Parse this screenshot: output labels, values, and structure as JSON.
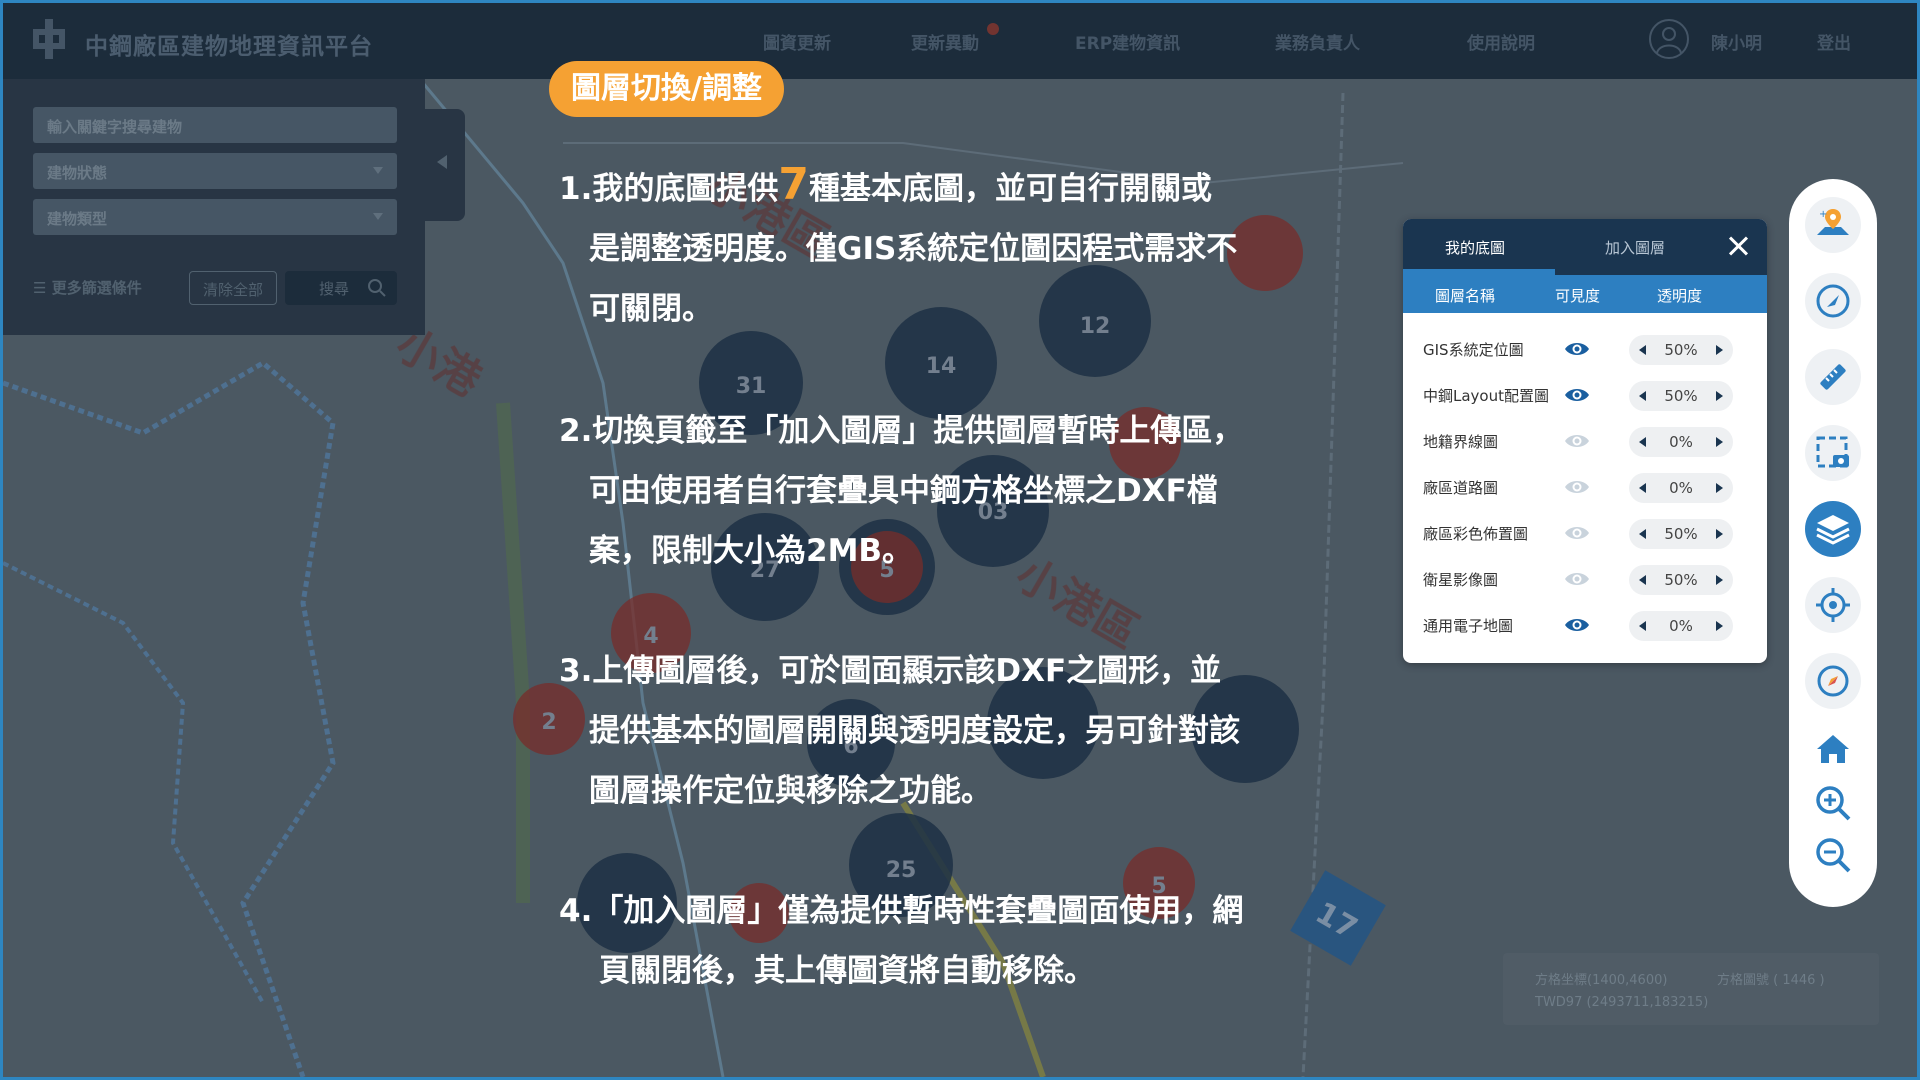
{
  "header": {
    "brand": "中鋼廠區建物地理資訊平台",
    "nav": [
      "圖資更新",
      "更新異動",
      "ERP建物資訊",
      "業務負責人",
      "使用說明"
    ],
    "user": "陳小明",
    "logout": "登出"
  },
  "search": {
    "keyword_placeholder": "輸入關鍵字搜尋建物",
    "status": "建物狀態",
    "type": "建物類型",
    "more": "更多篩選條件",
    "clear": "清除全部",
    "search": "搜尋"
  },
  "tutorial": {
    "pill": "圖層切換/調整",
    "p1_pre": "1.我的底圖提供",
    "p1_num": "7",
    "p1_post": "種基本底圖，並可自行開關或",
    "p1_l2": "是調整透明度。僅GIS系統定位圖因程式需求不",
    "p1_l3": "可關閉。",
    "p2_l1": "2.切換頁籤至「加入圖層」提供圖層暫時上傳區，",
    "p2_l2": "可由使用者自行套疊具中鋼方格坐標之DXF檔",
    "p2_l3": "案，限制大小為2MB。",
    "p3_l1": "3.上傳圖層後，可於圖面顯示該DXF之圖形，並",
    "p3_l2": "提供基本的圖層開關與透明度設定，另可針對該",
    "p3_l3": "圖層操作定位與移除之功能。",
    "p4_l1": "4.「加入圖層」僅為提供暫時性套疊圖面使用，網",
    "p4_l2": "頁關閉後，其上傳圖資將自動移除。"
  },
  "layer_panel": {
    "tab_basemap": "我的底圖",
    "tab_add": "加入圖層",
    "col_name": "圖層名稱",
    "col_visible": "可見度",
    "col_opacity": "透明度",
    "layers": [
      {
        "name": "GIS系統定位圖",
        "visible": true,
        "opacity": "50%"
      },
      {
        "name": "中鋼Layout配置圖",
        "visible": true,
        "opacity": "50%"
      },
      {
        "name": "地籍界線圖",
        "visible": false,
        "opacity": "0%"
      },
      {
        "name": "廠區道路圖",
        "visible": false,
        "opacity": "0%"
      },
      {
        "name": "廠區彩色佈置圖",
        "visible": false,
        "opacity": "50%"
      },
      {
        "name": "衛星影像圖",
        "visible": false,
        "opacity": "50%"
      },
      {
        "name": "通用電子地圖",
        "visible": true,
        "opacity": "0%"
      }
    ]
  },
  "map": {
    "clusters": [
      "31",
      "14",
      "12",
      "03",
      "27",
      "5",
      "4",
      "2",
      "6",
      "25",
      "5",
      "17"
    ],
    "labels": [
      "小港區",
      "小港區",
      "小港區"
    ]
  },
  "coords": {
    "grid": "方格坐標(1400,4600)",
    "grid_no": "方格圖號 ( 1446 )",
    "twd": "TWD97 (2493711,183215)"
  },
  "colors": {
    "accent": "#2d7fc1",
    "highlight": "#f5a133",
    "header": "#1d2c3b"
  }
}
